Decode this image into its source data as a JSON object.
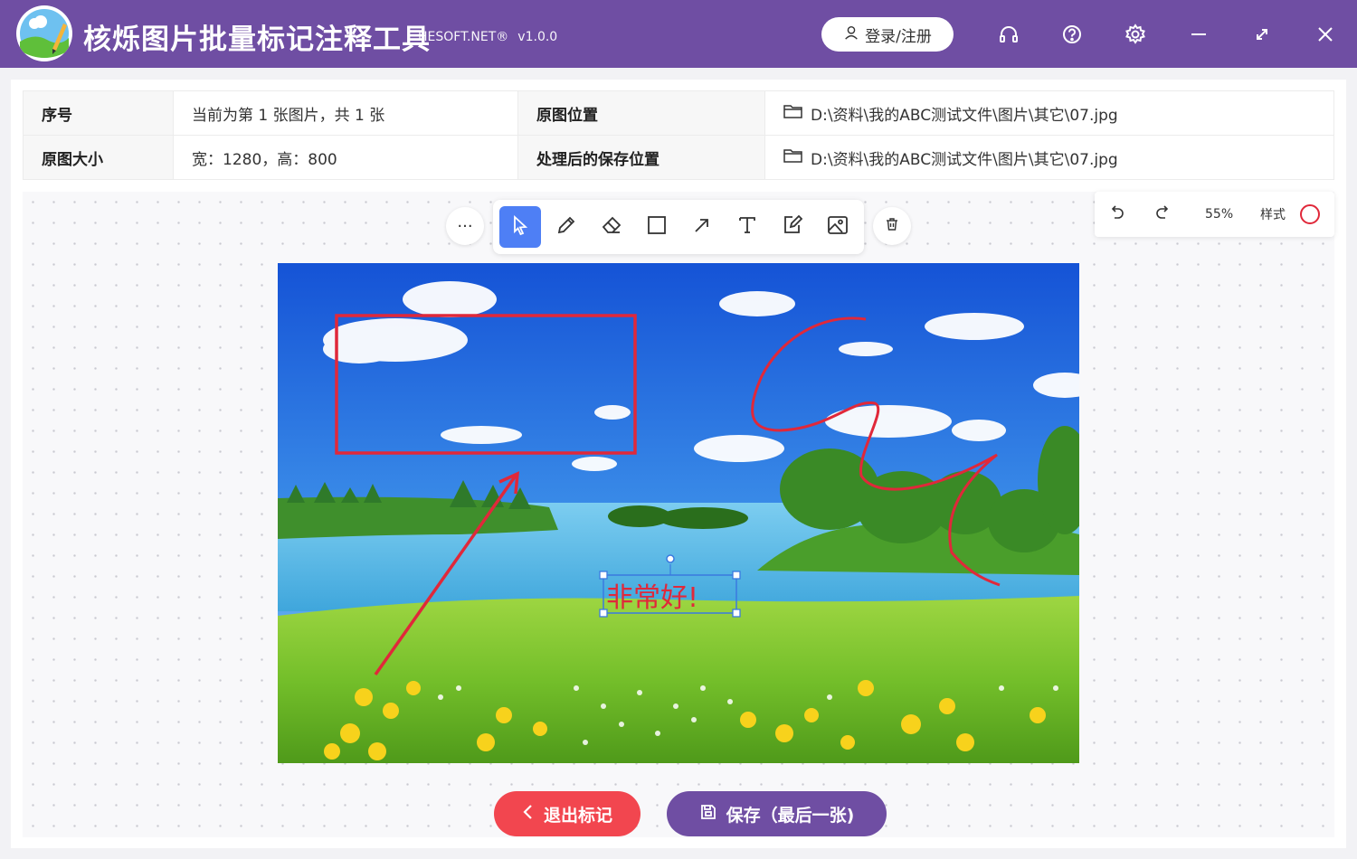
{
  "app": {
    "title": "核烁图片批量标记注释工具",
    "brand": "HESOFT.NET®",
    "version": "v1.0.0",
    "login_label": "登录/注册"
  },
  "info": {
    "index_label": "序号",
    "index_value": "当前为第 1 张图片，共 1 张",
    "source_label": "原图位置",
    "source_path": "D:\\资料\\我的ABC测试文件\\图片\\其它\\07.jpg",
    "size_label": "原图大小",
    "size_value": "宽：1280，高：800",
    "save_label": "处理后的保存位置",
    "save_path": "D:\\资料\\我的ABC测试文件\\图片\\其它\\07.jpg"
  },
  "panel": {
    "zoom": "55%",
    "style_label": "样式"
  },
  "annotation": {
    "text": "非常好!"
  },
  "buttons": {
    "exit": "退出标记",
    "save": "保存（最后一张)"
  },
  "colors": {
    "titlebar": "#6f4ea3",
    "accent": "#4e7ff5",
    "annotation_red": "#e0283a",
    "exit_button": "#f2464f",
    "save_button": "#6f4ea3"
  },
  "icons": [
    "user-icon",
    "headset-icon",
    "help-icon",
    "gear-icon",
    "minimize-icon",
    "maximize-icon",
    "close-icon",
    "folder-icon",
    "more-icon",
    "select-cursor-icon",
    "pencil-icon",
    "eraser-icon",
    "rectangle-icon",
    "arrow-icon",
    "text-icon",
    "edit-note-icon",
    "image-icon",
    "trash-icon",
    "undo-icon",
    "redo-icon",
    "chevron-left-icon",
    "save-icon"
  ]
}
